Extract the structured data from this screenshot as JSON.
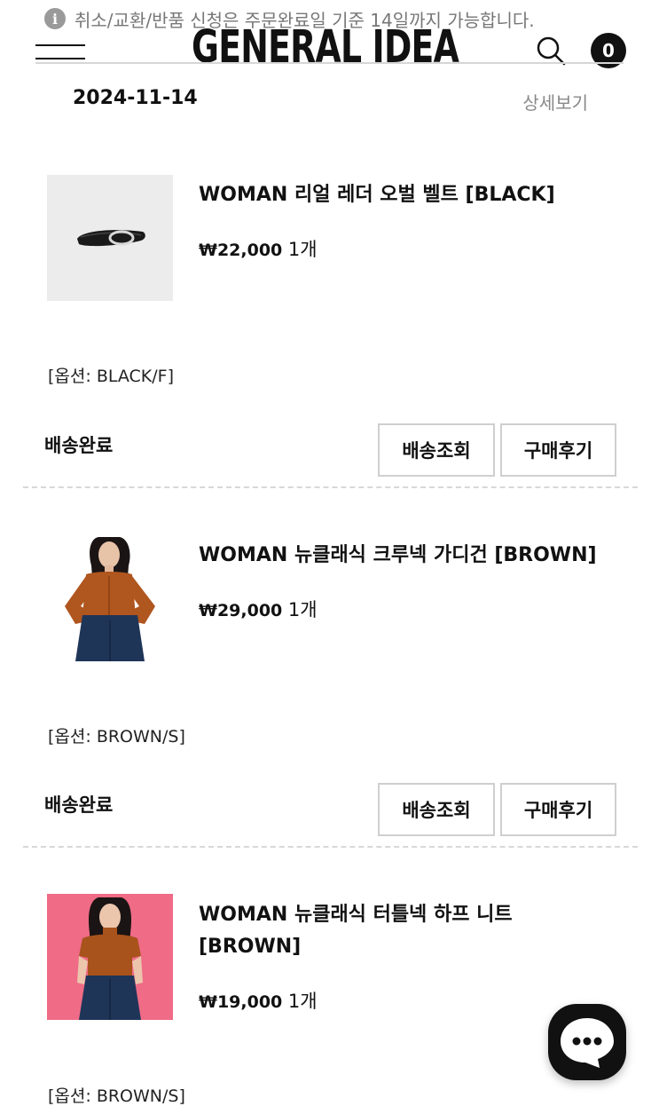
{
  "notice": {
    "text": "취소/교환/반품 신청은 주문완료일 기준 14일까지 가능합니다.",
    "icon": "info-icon"
  },
  "header": {
    "logo": "GENERAL IDEA",
    "menu_icon": "hamburger-menu-icon",
    "search_icon": "search-icon",
    "cart_count": "0"
  },
  "order": {
    "date": "2024-11-14",
    "details_label": "상세보기"
  },
  "items": [
    {
      "name": "WOMAN 리얼 레더 오벌 벨트 [BLACK]",
      "price": "₩22,000",
      "qty": "1개",
      "option": "[옵션: BLACK/F]",
      "status": "배송완료",
      "track_label": "배송조회",
      "review_label": "구매후기",
      "thumb_bg": "#ececec"
    },
    {
      "name": "WOMAN 뉴클래식 크루넥 가디건 [BROWN]",
      "price": "₩29,000",
      "qty": "1개",
      "option": "[옵션: BROWN/S]",
      "status": "배송완료",
      "track_label": "배송조회",
      "review_label": "구매후기",
      "thumb_bg": "#ffffff"
    },
    {
      "name": "WOMAN 뉴클래식 터틀넥 하프 니트 [BROWN]",
      "price": "₩19,000",
      "qty": "1개",
      "option": "[옵션: BROWN/S]",
      "thumb_bg": "#ef6b86"
    }
  ],
  "chat": {
    "icon": "chat-bubble-icon"
  },
  "colors": {
    "text": "#111111",
    "muted": "#888888",
    "border": "#cfcfcf",
    "divider": "#d8d8d8"
  }
}
